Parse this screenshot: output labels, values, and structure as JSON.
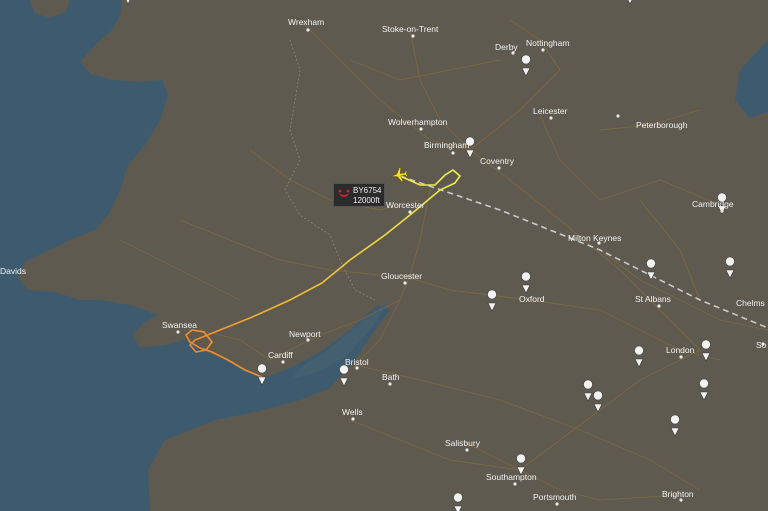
{
  "flight": {
    "callsign": "BY6754",
    "altitude": "12000ft"
  },
  "places": [
    {
      "name": "Wrexham"
    },
    {
      "name": "Stoke-on-Trent"
    },
    {
      "name": "Derby"
    },
    {
      "name": "Nottingham"
    },
    {
      "name": "Wolverhampton"
    },
    {
      "name": "Leicester"
    },
    {
      "name": "Peterborough"
    },
    {
      "name": "Birmingham"
    },
    {
      "name": "Coventry"
    },
    {
      "name": "Worcester"
    },
    {
      "name": "Cambridge"
    },
    {
      "name": "Milton Keynes"
    },
    {
      "name": "Davids"
    },
    {
      "name": "Gloucester"
    },
    {
      "name": "Oxford"
    },
    {
      "name": "St Albans"
    },
    {
      "name": "Chelms"
    },
    {
      "name": "Swansea"
    },
    {
      "name": "Newport"
    },
    {
      "name": "Cardiff"
    },
    {
      "name": "London"
    },
    {
      "name": "Bristol"
    },
    {
      "name": "Bath"
    },
    {
      "name": "Wells"
    },
    {
      "name": "Salisbury"
    },
    {
      "name": "Southampton"
    },
    {
      "name": "Portsmouth"
    },
    {
      "name": "Brighton"
    },
    {
      "name": "So"
    }
  ],
  "colors": {
    "sea": "#3d5a6e",
    "land": "#5e5a4f",
    "roads": "#8a6a3c",
    "track_start": "#f07830",
    "track_end": "#eef050",
    "aircraft": "#f5e020",
    "planned_route": "#c8c8c8"
  }
}
